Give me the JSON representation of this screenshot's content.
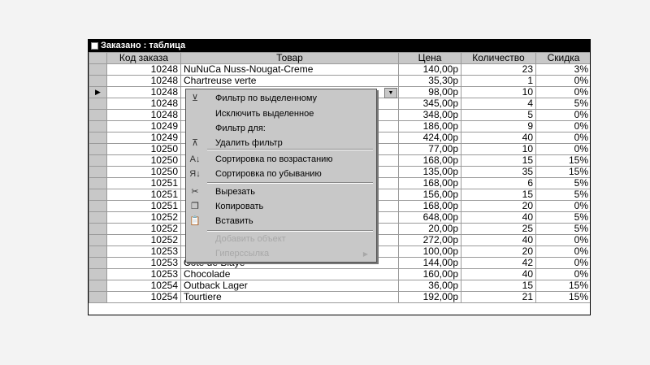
{
  "window": {
    "title": "Заказано : таблица"
  },
  "columns": [
    "Код заказа",
    "Товар",
    "Цена",
    "Количество",
    "Скидка"
  ],
  "rows": [
    [
      "10248",
      "NuNuCa Nuss-Nougat-Creme",
      "140,00р",
      "23",
      "3%"
    ],
    [
      "10248",
      "Chartreuse verte",
      "35,30р",
      "1",
      "0%"
    ],
    [
      "10248",
      "",
      "98,00р",
      "10",
      "0%"
    ],
    [
      "10248",
      "",
      "345,00р",
      "4",
      "5%"
    ],
    [
      "10248",
      "",
      "348,00р",
      "5",
      "0%"
    ],
    [
      "10249",
      "",
      "186,00р",
      "9",
      "0%"
    ],
    [
      "10249",
      "",
      "424,00р",
      "40",
      "0%"
    ],
    [
      "10250",
      "",
      "77,00р",
      "10",
      "0%"
    ],
    [
      "10250",
      "",
      "168,00р",
      "15",
      "15%"
    ],
    [
      "10250",
      "",
      "135,00р",
      "35",
      "15%"
    ],
    [
      "10251",
      "",
      "168,00р",
      "6",
      "5%"
    ],
    [
      "10251",
      "",
      "156,00р",
      "15",
      "5%"
    ],
    [
      "10251",
      "",
      "168,00р",
      "20",
      "0%"
    ],
    [
      "10252",
      "",
      "648,00р",
      "40",
      "5%"
    ],
    [
      "10252",
      "",
      "20,00р",
      "25",
      "5%"
    ],
    [
      "10252",
      "",
      "272,00р",
      "40",
      "0%"
    ],
    [
      "10253",
      "",
      "100,00р",
      "20",
      "0%"
    ],
    [
      "10253",
      "Cote de Blaye",
      "144,00р",
      "42",
      "0%"
    ],
    [
      "10253",
      "Chocolade",
      "160,00р",
      "40",
      "0%"
    ],
    [
      "10254",
      "Outback Lager",
      "36,00р",
      "15",
      "15%"
    ],
    [
      "10254",
      "Tourtiere",
      "192,00р",
      "21",
      "15%"
    ]
  ],
  "current_row_marker": "▶",
  "context_menu": {
    "items": [
      {
        "label": "Фильтр по выделенному",
        "icon": "filter-selection-icon",
        "glyph": "⊻"
      },
      {
        "label": "Исключить выделенное",
        "icon": "",
        "glyph": ""
      },
      {
        "label": "Фильтр для:",
        "icon": "",
        "glyph": ""
      },
      {
        "label": "Удалить фильтр",
        "icon": "remove-filter-icon",
        "glyph": "⊼"
      },
      {
        "label": "Сортировка по возрастанию",
        "icon": "sort-ascending-icon",
        "glyph": "A↓"
      },
      {
        "label": "Сортировка по убыванию",
        "icon": "sort-descending-icon",
        "glyph": "Я↓"
      },
      {
        "label": "Вырезать",
        "icon": "cut-icon",
        "glyph": "✂"
      },
      {
        "label": "Копировать",
        "icon": "copy-icon",
        "glyph": "❐"
      },
      {
        "label": "Вставить",
        "icon": "paste-icon",
        "glyph": "📋"
      },
      {
        "label": "Добавить объект",
        "icon": "",
        "glyph": ""
      },
      {
        "label": "Гиперссылка",
        "icon": "",
        "glyph": ""
      }
    ]
  }
}
